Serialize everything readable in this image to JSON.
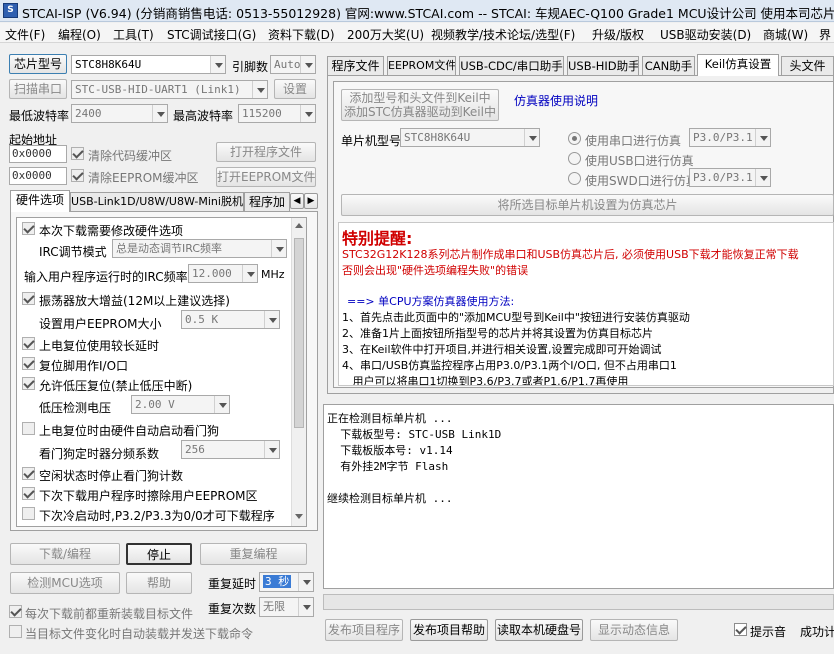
{
  "titlebar": {
    "title": "STCAI-ISP (V6.94) (分销商销售电话: 0513-55012928) 官网:www.STCAI.com  -- STCAI: 车规AEC-Q100 Grade1 MCU设计公司 使用本司芯片或采..."
  },
  "menu": [
    "文件(F)",
    "编程(O)",
    "工具(T)",
    "STC调试接口(G)",
    "资料下载(D)",
    "200万大奖(U)",
    "视频教学/技术论坛/选型(F)",
    "升级/版权",
    "USB驱动安装(D)",
    "商城(W)",
    "界"
  ],
  "left": {
    "chip_model_btn": "芯片型号",
    "chip_model_value": "STC8H8K64U",
    "pin_count_label": "引脚数",
    "pin_count_value": "Auto",
    "scan_port_btn": "扫描串口",
    "port_value": "STC-USB-HID-UART1 (Link1)",
    "settings_btn": "设置",
    "min_baud_label": "最低波特率",
    "min_baud_value": "2400",
    "max_baud_label": "最高波特率",
    "max_baud_value": "115200",
    "start_addr_label": "起始地址",
    "addr1_value": "0x0000",
    "clear_code_label": "清除代码缓冲区",
    "open_prog_btn": "打开程序文件",
    "addr2_value": "0x0000",
    "clear_eeprom_label": "清除EEPROM缓冲区",
    "open_eeprom_btn": "打开EEPROM文件",
    "tabs": [
      "硬件选项",
      "USB-Link1D/U8W/U8W-Mini脱机",
      "程序加"
    ],
    "hw_options": {
      "opt1": "本次下载需要修改硬件选项",
      "irc_mode_label": "IRC调节模式",
      "irc_mode_value": "总是动态调节IRC频率",
      "irc_freq_label": "输入用户程序运行时的IRC频率",
      "irc_freq_value": "12.000",
      "irc_freq_unit": "MHz",
      "opt_osc": "振荡器放大增益(12M以上建议选择)",
      "eeprom_size_label": "设置用户EEPROM大小",
      "eeprom_size_value": "0.5 K",
      "opt_por": "上电复位使用较长延时",
      "opt_reset_io": "复位脚用作I/O口",
      "opt_lvr": "允许低压复位(禁止低压中断)",
      "lvd_label": "低压检测电压",
      "lvd_value": "2.00 V",
      "opt_wdt_hw": "上电复位时由硬件自动启动看门狗",
      "wdt_div_label": "看门狗定时器分频系数",
      "wdt_div_value": "256",
      "opt_wdt_idle": "空闲状态时停止看门狗计数",
      "opt_erase_eeprom": "下次下载用户程序时擦除用户EEPROM区",
      "opt_p32": "下次冷启动时,P3.2/P3.3为0/0才可下载程序"
    },
    "download_btn": "下载/编程",
    "stop_btn": "停止",
    "reprogram_btn": "重复编程",
    "detect_btn": "检测MCU选项",
    "help_btn": "帮助",
    "repeat_delay_label": "重复延时",
    "repeat_delay_value": "3 秒",
    "repeat_count_label": "重复次数",
    "repeat_count_value": "无限",
    "reload_label": "每次下载前都重新装载目标文件",
    "auto_reload_label": "当目标文件变化时自动装载并发送下载命令"
  },
  "right": {
    "tabs": [
      "程序文件",
      "EEPROM文件",
      "USB-CDC/串口助手",
      "USB-HID助手",
      "CAN助手",
      "Keil仿真设置",
      "头文件"
    ],
    "add_keil_btn_line1": "添加型号和头文件到Keil中",
    "add_keil_btn_line2": "添加STC仿真器驱动到Keil中",
    "emulator_help": "仿真器使用说明",
    "mcu_model_label": "单片机型号",
    "mcu_model_value": "STC8H8K64U",
    "serial_emu_label": "使用串口进行仿真",
    "serial_emu_value": "P3.0/P3.1",
    "usb_emu_label": "使用USB口进行仿真",
    "swd_emu_label": "使用SWD口进行仿真",
    "swd_emu_value": "P3.0/P3.1",
    "set_emu_btn": "将所选目标单片机设置为仿真芯片",
    "notice_title": "特别提醒:",
    "notice_line1": "STC32G12K128系列芯片制作成串口和USB仿真芯片后, 必须使用USB下载才能恢复正常下载",
    "notice_line2": "否则会出现\"硬件选项编程失败\"的错误",
    "method_title": "==> 单CPU方案仿真器使用方法:",
    "steps": [
      "1、首先点击此页面中的\"添加MCU型号到Keil中\"按钮进行安装仿真驱动",
      "2、准备1片上面按钮所指型号的芯片并将其设置为仿真目标芯片",
      "3、在Keil软件中打开项目,并进行相关设置,设置完成即可开始调试",
      "4、串口/USB仿真监控程序占用P3.0/P3.1两个I/O口, 但不占用串口1",
      "   用户可以将串口1切换到P3.6/P3.7或者P1.6/P1.7再使用"
    ],
    "log": [
      "正在检测目标单片机 ...",
      "  下载板型号: STC-USB Link1D",
      "  下载板版本号: v1.14",
      "  有外挂2M字节 Flash",
      "",
      "继续检测目标单片机 ..."
    ],
    "publish_prog_btn": "发布项目程序",
    "publish_help_btn": "发布项目帮助",
    "read_disk_btn": "读取本机硬盘号",
    "show_dynamic_btn": "显示动态信息",
    "beep_label": "提示音",
    "success_label": "成功计"
  }
}
